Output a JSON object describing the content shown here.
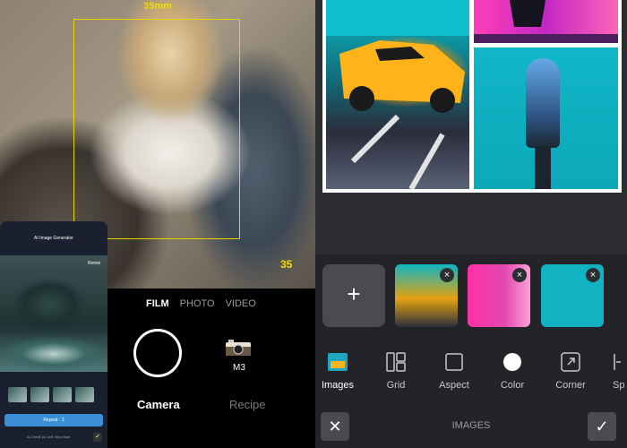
{
  "left": {
    "frame_label_top": "35mm",
    "frame_label_right": "35",
    "modes": [
      "FILM",
      "PHOTO",
      "VIDEO"
    ],
    "active_mode": "FILM",
    "camera_model": "M3",
    "tabs": [
      "Camera",
      "Recipe"
    ],
    "active_tab": "Camera",
    "inset": {
      "title": "AI Image Generator",
      "remix_label": "Remix",
      "repeat_label": "Repeat · 2",
      "footer_text": "AI Credit (s) Left: Buy More"
    }
  },
  "right": {
    "tools": [
      {
        "label": "Images",
        "icon": "images-icon"
      },
      {
        "label": "Grid",
        "icon": "grid-icon"
      },
      {
        "label": "Aspect",
        "icon": "aspect-icon"
      },
      {
        "label": "Color",
        "icon": "color-icon"
      },
      {
        "label": "Corner",
        "icon": "corner-icon"
      },
      {
        "label": "Sp",
        "icon": "spacing-icon"
      }
    ],
    "active_tool": "Images",
    "bottom_title": "IMAGES",
    "add_label": "+",
    "accent": "#f2dc00"
  }
}
